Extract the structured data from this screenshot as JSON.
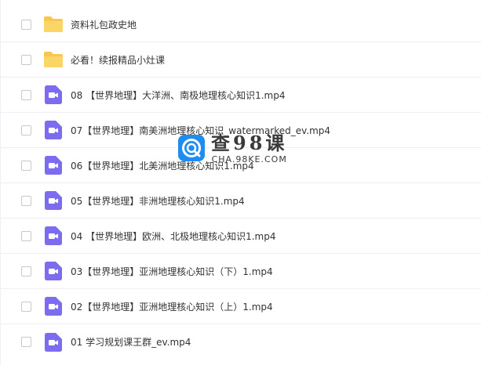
{
  "files": [
    {
      "type": "folder",
      "name": "资料礼包政史地"
    },
    {
      "type": "folder",
      "name": "必看！续报精品小灶课"
    },
    {
      "type": "video",
      "name": "08 【世界地理】大洋洲、南极地理核心知识1.mp4"
    },
    {
      "type": "video",
      "name": "07【世界地理】南美洲地理核心知识_watermarked_ev.mp4"
    },
    {
      "type": "video",
      "name": "06【世界地理】北美洲地理核心知识1.mp4"
    },
    {
      "type": "video",
      "name": "05【世界地理】非洲地理核心知识1.mp4"
    },
    {
      "type": "video",
      "name": "04 【世界地理】欧洲、北极地理核心知识1.mp4"
    },
    {
      "type": "video",
      "name": "03【世界地理】亚洲地理核心知识（下）1.mp4"
    },
    {
      "type": "video",
      "name": "02【世界地理】亚洲地理核心知识（上）1.mp4"
    },
    {
      "type": "video",
      "name": "01 学习规划课王群_ev.mp4"
    }
  ],
  "watermark": {
    "title": "查98课",
    "subtitle": "CHA.98KE.COM"
  },
  "colors": {
    "folder": "#f8c74e",
    "video": "#7b6cf0",
    "watermark_blue": "#1f8df0"
  }
}
